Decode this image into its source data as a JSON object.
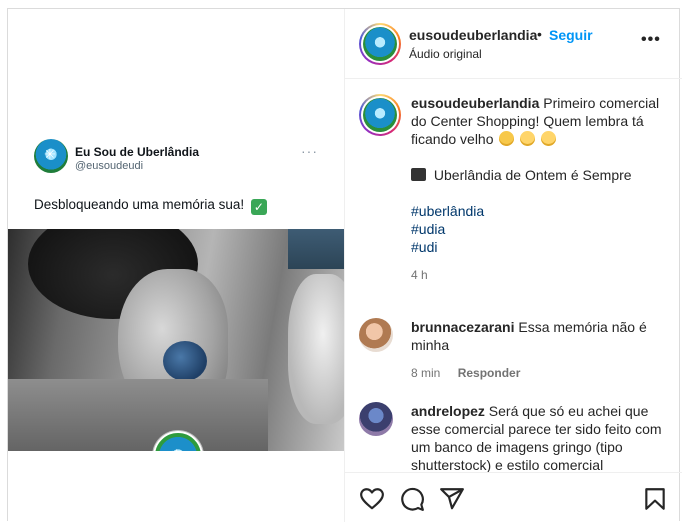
{
  "tweet": {
    "name": "Eu Sou de Uberlândia",
    "handle": "@eusoudeudi",
    "text": "Desbloqueando uma memória sua!",
    "more": "···"
  },
  "header": {
    "username": "eusoudeuberlandia",
    "dot": "•",
    "follow_label": "Seguir",
    "audio": "Áudio original",
    "more": "•••"
  },
  "caption": {
    "username": "eusoudeuberlandia",
    "text": "Primeiro comercial do Center Shopping! Quem lembra tá ficando velho",
    "line2": "Uberlândia de Ontem é Sempre",
    "tags": [
      "#uberlândia",
      "#udia",
      "#udi"
    ],
    "time": "4 h"
  },
  "comments": [
    {
      "username": "brunnacezarani",
      "text": "Essa memória não é minha",
      "time": "8 min",
      "reply_label": "Responder"
    },
    {
      "username": "andrelopez",
      "text": "Será que só eu achei que esse comercial parece ter sido feito com um banco de imagens gringo (tipo shutterstock) e estilo comercial americano?"
    }
  ],
  "colors": {
    "accent": "#0095f6",
    "hashtag": "#00376b",
    "muted": "#737373"
  },
  "icons": [
    "heart-icon",
    "comment-icon",
    "share-icon",
    "bookmark-icon"
  ]
}
